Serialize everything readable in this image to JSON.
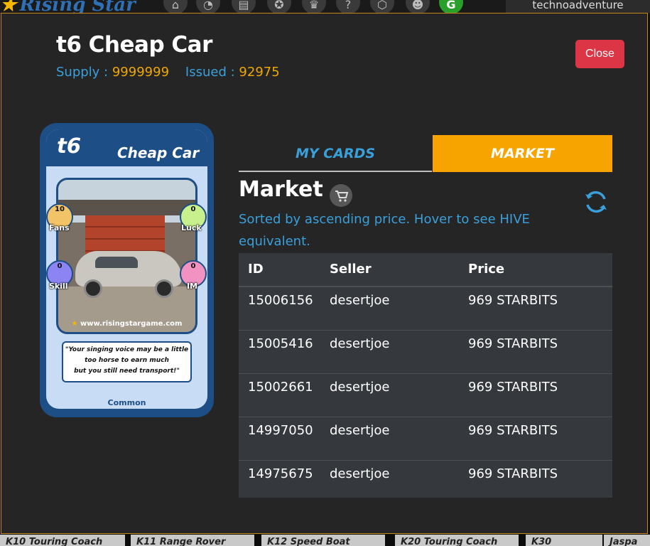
{
  "site": {
    "logo_text": "Rising Star",
    "username": "technoadventure",
    "bg_cards": [
      "K10 Touring Coach",
      "K11 Range Rover",
      "K12 Speed Boat",
      "K20 Touring Coach",
      "K30",
      "Jaspa"
    ]
  },
  "modal": {
    "title": "t6 Cheap Car",
    "supply_label": "Supply :",
    "supply_value": "9999999",
    "issued_label": "Issued :",
    "issued_value": "92975",
    "close_label": "Close"
  },
  "card": {
    "tier": "t6",
    "name": "Cheap Car",
    "stats": {
      "fans": {
        "label": "Fans",
        "value": "10"
      },
      "luck": {
        "label": "Luck",
        "value": "0"
      },
      "skill": {
        "label": "Skill",
        "value": "0"
      },
      "im": {
        "label": "IM",
        "value": "0"
      }
    },
    "website": "www.risingstargame.com",
    "quote_lines": [
      "\"Your singing voice may be a little",
      "too horse to earn much",
      "but you still need transport!\""
    ],
    "rarity": "Common"
  },
  "tabs": [
    {
      "label": "MY CARDS",
      "active": false
    },
    {
      "label": "MARKET",
      "active": true
    }
  ],
  "market": {
    "title": "Market",
    "note": "Sorted by ascending price. Hover to see HIVE equivalent.",
    "columns": [
      "ID",
      "Seller",
      "Price"
    ],
    "rows": [
      {
        "id": "15006156",
        "seller": "desertjoe",
        "price": "969 STARBITS"
      },
      {
        "id": "15005416",
        "seller": "desertjoe",
        "price": "969 STARBITS"
      },
      {
        "id": "15002661",
        "seller": "desertjoe",
        "price": "969 STARBITS"
      },
      {
        "id": "14997050",
        "seller": "desertjoe",
        "price": "969 STARBITS"
      },
      {
        "id": "14975675",
        "seller": "desertjoe",
        "price": "969 STARBITS"
      }
    ]
  },
  "colors": {
    "accent_blue": "#3aa0db",
    "accent_orange": "#f7a400",
    "close_red": "#dc3545",
    "card_navy": "#1d4e86"
  },
  "icons": [
    "home-icon",
    "gauge-icon",
    "cards-icon",
    "medal-icon",
    "trophy-icon",
    "help-icon",
    "hive-icon",
    "discord-icon",
    "g-icon",
    "cart-icon",
    "refresh-icon"
  ]
}
